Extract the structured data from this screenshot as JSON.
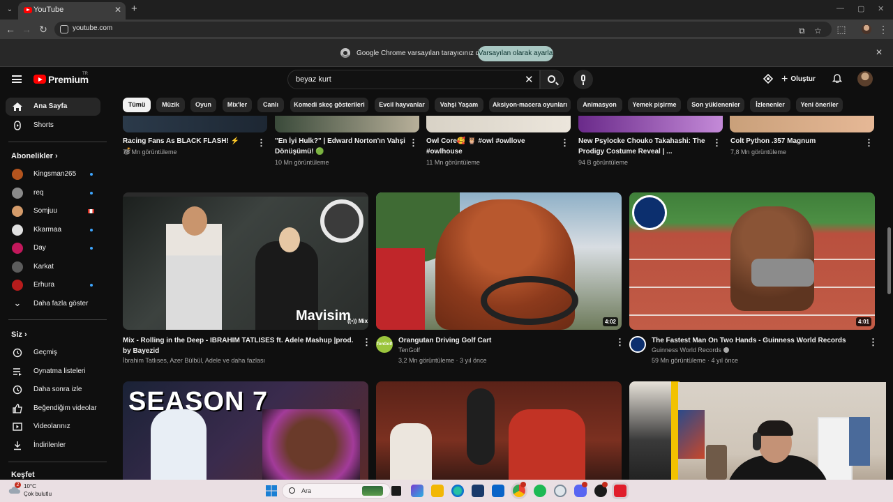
{
  "browser": {
    "tab_title": "YouTube",
    "url": "youtube.com",
    "infobar_message": "Google Chrome varsayılan tarayıcınız değil",
    "infobar_button": "Varsayılan olarak ayarla"
  },
  "masthead": {
    "brand": "Premium",
    "region": "TR",
    "search_query": "beyaz kurt",
    "create_label": "Oluştur"
  },
  "sidebar": {
    "main": [
      {
        "label": "Ana Sayfa"
      },
      {
        "label": "Shorts"
      }
    ],
    "subscriptions_heading": "Abonelikler",
    "subscriptions": [
      {
        "label": "Kingsman265",
        "status": "new",
        "color": "#b3541e"
      },
      {
        "label": "req",
        "status": "new",
        "color": "#8a8a8a"
      },
      {
        "label": "Somjuu",
        "status": "live",
        "color": "#d49b6a"
      },
      {
        "label": "Kkarmaa",
        "status": "new",
        "color": "#e0e0e0"
      },
      {
        "label": "Day",
        "status": "new",
        "color": "#c2185b"
      },
      {
        "label": "Karkat",
        "status": "none",
        "color": "#5c5c5c"
      },
      {
        "label": "Erhura",
        "status": "new",
        "color": "#b71c1c"
      }
    ],
    "more_label": "Daha fazla göster",
    "you_heading": "Siz",
    "you_items": [
      {
        "label": "Geçmiş",
        "icon": "history-icon"
      },
      {
        "label": "Oynatma listeleri",
        "icon": "playlists-icon"
      },
      {
        "label": "Daha sonra izle",
        "icon": "watch-later-icon"
      },
      {
        "label": "Beğendiğim videolar",
        "icon": "liked-icon"
      },
      {
        "label": "Videolarınız",
        "icon": "your-videos-icon"
      },
      {
        "label": "İndirilenler",
        "icon": "downloads-icon"
      }
    ],
    "explore_heading": "Keşfet"
  },
  "chips": [
    "Tümü",
    "Müzik",
    "Oyun",
    "Mix'ler",
    "Canlı",
    "Komedi skeç gösterileri",
    "Evcil hayvanlar",
    "Vahşi Yaşam",
    "Aksiyon-macera oyunları",
    "Animasyon",
    "Yemek pişirme",
    "Son yüklenenler",
    "İzlenenler",
    "Yeni öneriler"
  ],
  "top_row": [
    {
      "title1": "Racing Fans As BLACK FLASH! ⚡ 💣",
      "title2": "",
      "meta": "78 Mn görüntüleme"
    },
    {
      "title1": "\"En İyi Hulk?\" | Edward Norton'ın Vahşi",
      "title2": "Dönüşümü! 🟢",
      "meta": "10 Mn görüntüleme"
    },
    {
      "title1": "Owl Core🥰 🦉 #owl #owllove",
      "title2": "#owlhouse",
      "meta": "11 Mn görüntüleme"
    },
    {
      "title1": "New Psylocke Chouko Takahashi: The",
      "title2": "Prodigy Costume Reveal | ...",
      "meta": "94 B görüntüleme"
    },
    {
      "title1": "Colt Python .357 Magnum",
      "title2": "",
      "meta": "7,8 Mn görüntüleme"
    }
  ],
  "videos": [
    {
      "title1": "Mix - Rolling in the Deep - IBRAHIM TATLISES ft. Adele Mashup |prod.",
      "title2": "by Bayezid",
      "channel": "İbrahim Tatlıses, Azer Bülbül, Adele ve daha fazlası",
      "meta": "",
      "badge": "Mix",
      "overlay": "Mavisim"
    },
    {
      "title1": "Orangutan Driving Golf Cart",
      "title2": "",
      "channel": "TenGolf",
      "meta": "3,2 Mn görüntüleme · 3 yıl önce",
      "duration": "4:02",
      "avatar_text": "TenGolf"
    },
    {
      "title1": "The Fastest Man On Two Hands - Guinness World Records",
      "title2": "",
      "channel": "Guinness World Records",
      "meta": "59 Mn görüntüleme · 4 yıl önce",
      "duration": "4:01"
    }
  ],
  "bottom_row": [
    {
      "overlay": "SEASON 7"
    },
    {
      "overlay": ""
    },
    {
      "overlay": ""
    }
  ],
  "taskbar": {
    "temperature": "10°C",
    "condition": "Çok bulutlu",
    "weather_badge": "2",
    "search_label": "Ara"
  }
}
